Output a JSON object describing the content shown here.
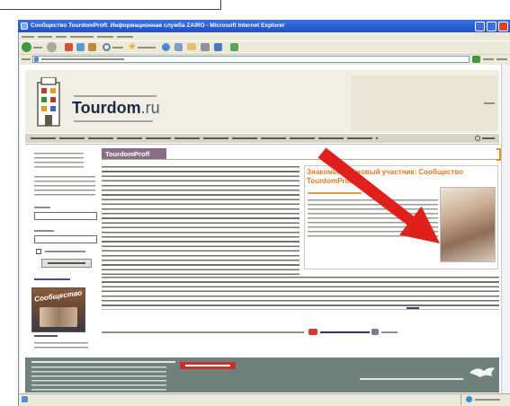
{
  "window": {
    "title": "Сообщество TourdomProff. Информационная служба ZAIRO - Microsoft Internet Explorer"
  },
  "site": {
    "logo_text": "Tourdom",
    "logo_suffix": ".ru"
  },
  "main": {
    "heading": "TourdomProff"
  },
  "featured": {
    "heading": "Знакомьтесь, новый участник: Сообщество TourdomProff"
  },
  "sidebar": {
    "banner_text": "Сообщество"
  },
  "toolbar": {
    "icons": [
      "back-icon",
      "forward-icon",
      "stop-icon",
      "refresh-icon",
      "home-icon",
      "search-icon",
      "favorites-icon",
      "media-icon",
      "history-icon",
      "mail-icon",
      "print-icon"
    ]
  },
  "colors": {
    "title_bar": "#2358d0",
    "heading_tab": "#8a6d88",
    "featured_heading": "#e07a20",
    "footer": "#6f817b",
    "arrow": "#e0201c"
  }
}
